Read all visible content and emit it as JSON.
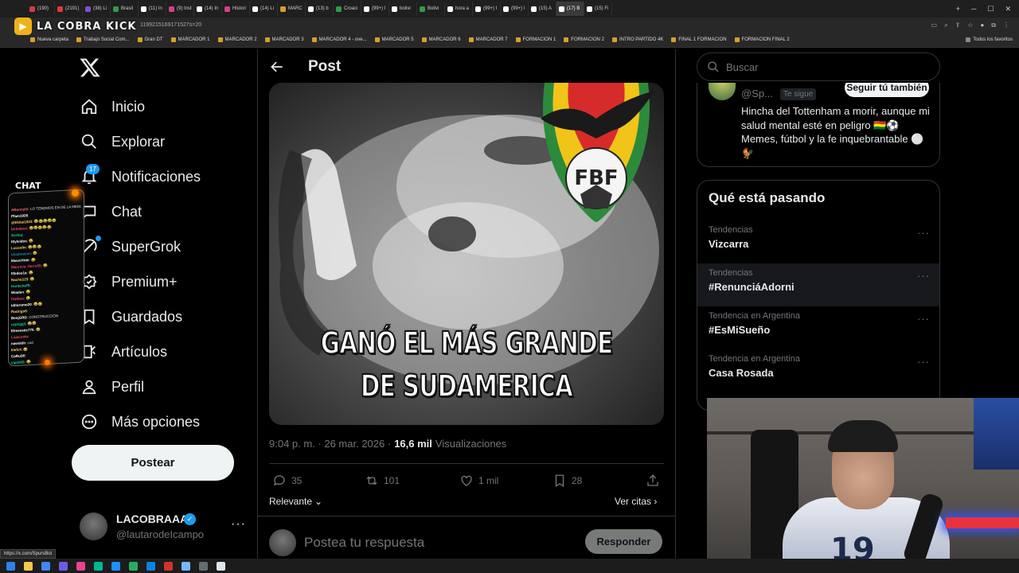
{
  "browser": {
    "tabs": [
      {
        "label": "(190)",
        "color": "#d63b3b"
      },
      {
        "label": "(2191)",
        "color": "#e03a3a"
      },
      {
        "label": "(38) Li",
        "color": "#7b51d6"
      },
      {
        "label": "Brasil",
        "color": "#2e9c4b"
      },
      {
        "label": "(11) In",
        "color": "#ffffff"
      },
      {
        "label": "(9) Inst",
        "color": "#d43f8d"
      },
      {
        "label": "(14) In",
        "color": "#ffffff"
      },
      {
        "label": "Histori",
        "color": "#d43f8d"
      },
      {
        "label": "(14) Li",
        "color": "#ffffff"
      },
      {
        "label": "MARC",
        "color": "#d6a02a"
      },
      {
        "label": "(13) b",
        "color": "#ffffff"
      },
      {
        "label": "Croaci",
        "color": "#2e9c4b"
      },
      {
        "label": "(99+) I",
        "color": "#ffffff"
      },
      {
        "label": "bolivi",
        "color": "#ffffff"
      },
      {
        "label": "Bolivi",
        "color": "#2e9c4b"
      },
      {
        "label": "hora a",
        "color": "#ffffff"
      },
      {
        "label": "(99+) I",
        "color": "#ffffff"
      },
      {
        "label": "(99+) I",
        "color": "#ffffff"
      },
      {
        "label": "(15) A",
        "color": "#ffffff"
      },
      {
        "label": "(17) B",
        "color": "#ffffff",
        "active": true
      },
      {
        "label": "(15) Fi",
        "color": "#ffffff"
      }
    ],
    "url_fragment": "1199215169171527s=20",
    "bookmarks": [
      "Nueva carpeta",
      "Trabajo Social Com...",
      "Gran DT",
      "MARCADOR 1",
      "MARCADOR 2",
      "MARCADOR 3",
      "MARCADOR 4 - ove...",
      "MARCADOR 5",
      "MARCADOR 6",
      "MARCADOR 7",
      "FORMACION 1",
      "FORMACION 2",
      "INTRO PARTIDO 4K",
      "FINAL 1 FORMACION",
      "FORMACION FINAL 2"
    ],
    "all_bookmarks": "Todos los favoritos",
    "status_url": "https://x.com/SpursBoi"
  },
  "stream": {
    "logo_text": "LA COBRA KICK",
    "chat_title": "CHAT",
    "chat_lines": [
      {
        "user": "ABonnyIV",
        "color": "#ff6b6b",
        "msg": "LO TENEMOS EN DE LA MEDIA SI PICHO"
      },
      {
        "user": "Pfam1926",
        "color": "#fff",
        "msg": ""
      },
      {
        "user": "@Ekitai1923",
        "color": "#ffd166",
        "msg": "😂😂😂😂😂"
      },
      {
        "user": "lorbalpxx",
        "color": "#ef476f",
        "msg": "😂😂😂😂😂"
      },
      {
        "user": "Sorbaj",
        "color": "#06d6a0",
        "msg": ""
      },
      {
        "user": "ISylvidos",
        "color": "#fff",
        "msg": "😂"
      },
      {
        "user": "Lucoxfin",
        "color": "#ffd166",
        "msg": "😂😂😂"
      },
      {
        "user": "oloalmacen",
        "color": "#118ab2",
        "msg": "😂"
      },
      {
        "user": "MiavcHnte",
        "color": "#fff",
        "msg": "😂"
      },
      {
        "user": "Mauricio_fierro55",
        "color": "#ef476f",
        "msg": "😂"
      },
      {
        "user": "Ilfedeo1a",
        "color": "#fff",
        "msg": "😂"
      },
      {
        "user": "Nacho123",
        "color": "#ffd166",
        "msg": "😂"
      },
      {
        "user": "Hunkchefft",
        "color": "#06d6a0",
        "msg": ""
      },
      {
        "user": "Wiaden",
        "color": "#fff",
        "msg": "😂"
      },
      {
        "user": "IValboo",
        "color": "#ef476f",
        "msg": "😂"
      },
      {
        "user": "iditoromo20",
        "color": "#fff",
        "msg": "😂😂"
      },
      {
        "user": "Rodrigo8",
        "color": "#ffd166",
        "msg": ""
      },
      {
        "user": "BenjGRD",
        "color": "#fff",
        "msg": "CONSTRUCCIÓN"
      },
      {
        "user": "ozpegg3",
        "color": "#06d6a0",
        "msg": "😂😂"
      },
      {
        "user": "Elmesstic775",
        "color": "#fff",
        "msg": "😂"
      },
      {
        "user": "Lujacosto",
        "color": "#ef476f",
        "msg": ""
      },
      {
        "user": "nawistih",
        "color": "#fff",
        "msg": "cod"
      },
      {
        "user": "klefc4",
        "color": "#ffd166",
        "msg": "😂"
      },
      {
        "user": "CaRuD0",
        "color": "#fff",
        "msg": ""
      },
      {
        "user": "vip1005",
        "color": "#06d6a0",
        "msg": "😂"
      },
      {
        "user": "nosoamigo",
        "color": "#fff",
        "msg": "😂"
      },
      {
        "user": "leonar",
        "color": "#ef476f",
        "msg": "😂"
      },
      {
        "user": "jump",
        "color": "#fff",
        "msg": ""
      },
      {
        "user": "Ianrisgaid",
        "color": "#ffd166",
        "msg": "😂😂"
      },
      {
        "user": "Ianroche",
        "color": "#fff",
        "msg": "😂"
      },
      {
        "user": "Iosepeleo",
        "color": "#06d6a0",
        "msg": "😂"
      },
      {
        "user": "cador_151",
        "color": "#fff",
        "msg": "😂"
      }
    ]
  },
  "nav": {
    "items": [
      {
        "label": "Inicio",
        "icon": "home-icon"
      },
      {
        "label": "Explorar",
        "icon": "search-icon"
      },
      {
        "label": "Notificaciones",
        "icon": "bell-icon"
      },
      {
        "label": "Chat",
        "icon": "chat-icon"
      },
      {
        "label": "SuperGrok",
        "icon": "grok-icon"
      },
      {
        "label": "Premium+",
        "icon": "premium-icon"
      },
      {
        "label": "Guardados",
        "icon": "bookmark-icon"
      },
      {
        "label": "Artículos",
        "icon": "articles-icon"
      },
      {
        "label": "Perfil",
        "icon": "profile-icon"
      },
      {
        "label": "Más opciones",
        "icon": "more-icon"
      }
    ],
    "notif_count": "17",
    "post_button": "Postear"
  },
  "profile": {
    "name": "LACOBRAAA",
    "handle": "@lautarodeIcampo",
    "more": "···"
  },
  "post": {
    "header": "Post",
    "caption_line1": "GANÓ EL MÁS GRANDE",
    "caption_line2": "DE SUDAMERICA",
    "crest_text": "FBF",
    "time": "9:04 p. m. · 26 mar. 2026 ·",
    "views_num": "16,6 mil",
    "views_label": "Visualizaciones",
    "replies": "35",
    "reposts": "101",
    "likes": "1 mil",
    "bookmarks": "28",
    "sort_label": "Relevante",
    "quotes_link": "Ver citas",
    "reply_placeholder": "Postea tu respuesta",
    "reply_button": "Responder"
  },
  "sidebar": {
    "search_placeholder": "Buscar",
    "who": {
      "handle": "@Sp...",
      "follows_you": "Te sigue",
      "follow_button": "Seguir tú también",
      "bio": "Hincha del Tottenham a morir, aunque mi salud mental esté en peligro 🇧🇴⚽ Memes, fútbol y la fe inquebrantable ⚪🐓"
    },
    "trends_title": "Qué está pasando",
    "trends": [
      {
        "context": "Tendencias",
        "name": "Vizcarra"
      },
      {
        "context": "Tendencias",
        "name": "#RenunciáAdorni"
      },
      {
        "context": "Tendencia en Argentina",
        "name": "#EsMiSueño"
      },
      {
        "context": "Tendencia en Argentina",
        "name": "Casa Rosada"
      }
    ],
    "trend_more": "···"
  },
  "webcam": {
    "jersey_number": "19"
  },
  "colors": {
    "accent": "#1d9bf0",
    "background": "#000000",
    "text": "#e7e9ea",
    "muted": "#71767b",
    "border": "#2f3336"
  }
}
